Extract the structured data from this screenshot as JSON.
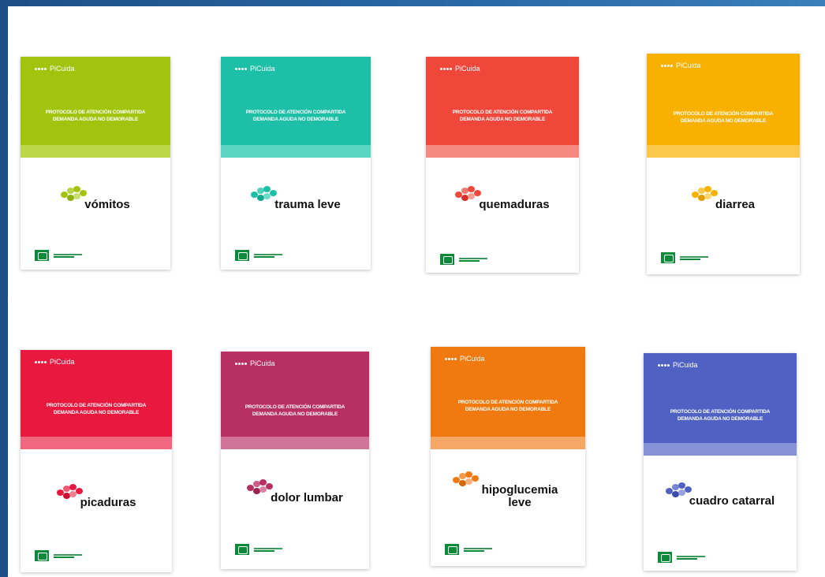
{
  "brand": "PiCuida",
  "protocol_line1": "PROTOCOLO DE ATENCIÓN COMPARTIDA",
  "protocol_line2": "DEMANDA AGUDA NO DEMORABLE",
  "covers": [
    {
      "topic": "vómitos",
      "color": "#a2c40e",
      "strip": "#bdd74a"
    },
    {
      "topic": "trauma leve",
      "color": "#1dbfa6",
      "strip": "#5ad6c2"
    },
    {
      "topic": "quemaduras",
      "color": "#f0473b",
      "strip": "#f48a82"
    },
    {
      "topic": "diarrea",
      "color": "#f8b100",
      "strip": "#fbc94a"
    },
    {
      "topic": "picaduras",
      "color": "#e8183f",
      "strip": "#ef6880"
    },
    {
      "topic": "dolor lumbar",
      "color": "#b82f63",
      "strip": "#cf7498"
    },
    {
      "topic": "hipoglucemia leve",
      "color": "#f07a0f",
      "strip": "#f5a866"
    },
    {
      "topic": "cuadro catarral",
      "color": "#4f62c3",
      "strip": "#8593d6"
    }
  ]
}
